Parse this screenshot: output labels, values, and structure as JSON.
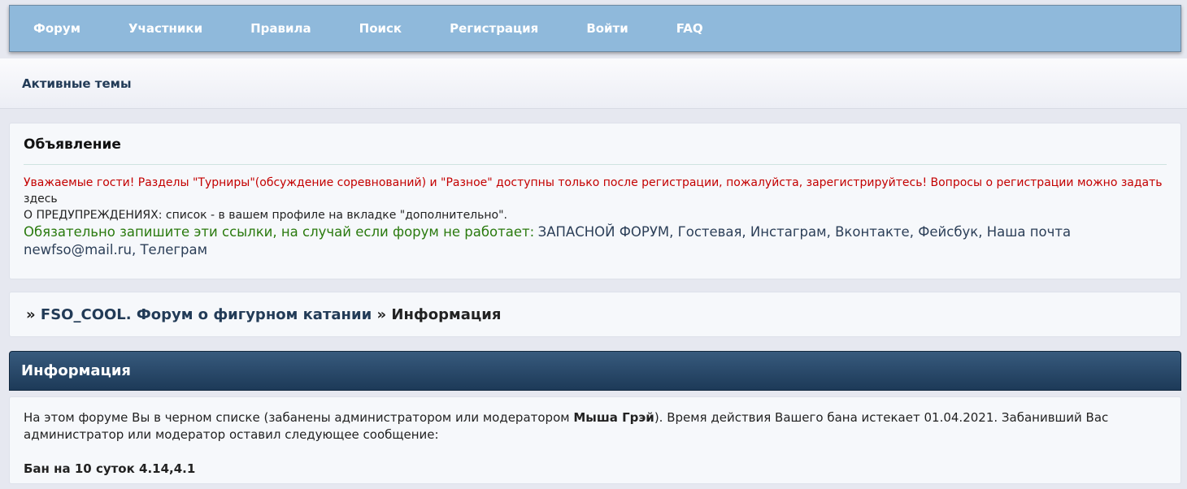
{
  "nav": {
    "items": [
      "Форум",
      "Участники",
      "Правила",
      "Поиск",
      "Регистрация",
      "Войти",
      "FAQ"
    ]
  },
  "subbar": {
    "active_topics": "Активные темы"
  },
  "announcement": {
    "title": "Объявление",
    "guest_notice": "Уважаемые гости! Разделы \"Турниры\"(обсуждение соревнований) и \"Разное\" доступны только после регистрации, пожалуйста, зарегистрируйтесь! Вопросы о регистрации можно задать",
    "guest_notice_link": "здесь",
    "warnings_line": "О ПРЕДУПРЕЖДЕНИЯХ: список - в вашем профиле на вкладке \"дополнительно\".",
    "links_intro": "Обязательно запишите эти ссылки, на случай если форум не работает:",
    "links": [
      "ЗАПАСНОЙ ФОРУМ",
      "Гостевая",
      "Инстаграм",
      "Вконтакте",
      "Фейсбук",
      "Наша почта newfso@mail.ru",
      "Телеграм"
    ]
  },
  "breadcrumb": {
    "sep": "»",
    "forum": "FSO_COOL. Форум о фигурном катании",
    "current": "Информация"
  },
  "info": {
    "heading": "Информация",
    "text_before": "На этом форуме Вы в черном списке (забанены администратором или модератором ",
    "moderator": "Мыша Грэй",
    "text_after": "). Время действия Вашего бана истекает 01.04.2021. Забанивший Вас администратор или модератор оставил следующее сообщение:",
    "ban_message": "Бан на 10 суток 4.14,4.1"
  }
}
